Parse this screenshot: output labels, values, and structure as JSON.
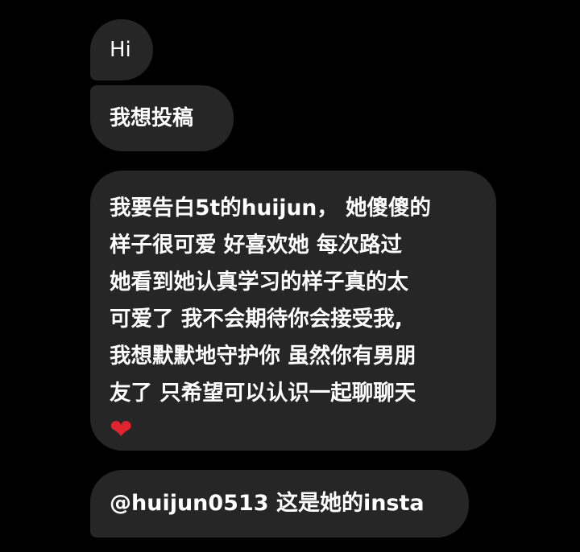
{
  "chat": {
    "messages": [
      {
        "text": "Hi"
      },
      {
        "text": "我想投稿"
      },
      {
        "lines": [
          "我要告白5t的huijun， 她傻傻的",
          "样子很可爱 好喜欢她 每次路过",
          "她看到她认真学习的样子真的太",
          "可爱了 我不会期待你会接受我,",
          "我想默默地守护你 虽然你有男朋",
          "友了 只希望可以认识一起聊聊天"
        ],
        "emoji": "❤"
      },
      {
        "text": "@huijun0513 这是她的insta"
      }
    ]
  },
  "colors": {
    "background": "#000000",
    "bubble": "#262626",
    "text": "#ffffff",
    "heart": "#e0242f"
  }
}
